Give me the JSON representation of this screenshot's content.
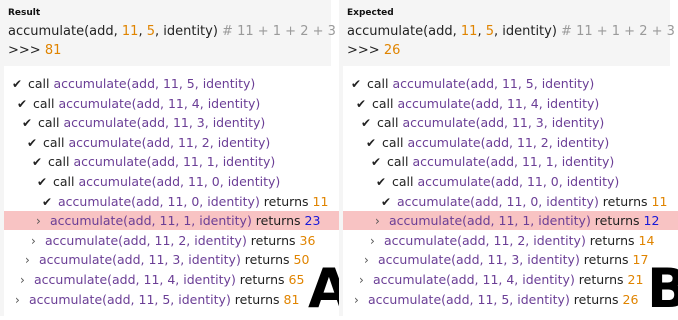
{
  "panels": [
    {
      "title": "Result",
      "expression": "accumulate(add, ",
      "arg1": "11",
      "arg2": "5",
      "expr_tail": ", identity)",
      "comment": " # 11 + 1 + 2 + 3",
      "prompt": ">>> ",
      "prompt_value": "81",
      "calls": [
        "accumulate(add, 11, 5, identity)",
        "accumulate(add, 11, 4, identity)",
        "accumulate(add, 11, 3, identity)",
        "accumulate(add, 11, 2, identity)",
        "accumulate(add, 11, 1, identity)",
        "accumulate(add, 11, 0, identity)"
      ],
      "returns": [
        {
          "call": "accumulate(add, 11, 0, identity)",
          "value": "11",
          "highlight": false
        },
        {
          "call": "accumulate(add, 11, 1, identity)",
          "value": "23",
          "highlight": true
        },
        {
          "call": "accumulate(add, 11, 2, identity)",
          "value": "36",
          "highlight": false
        },
        {
          "call": "accumulate(add, 11, 3, identity)",
          "value": "50",
          "highlight": false
        },
        {
          "call": "accumulate(add, 11, 4, identity)",
          "value": "65",
          "highlight": false
        },
        {
          "call": "accumulate(add, 11, 5, identity)",
          "value": "81",
          "highlight": false
        }
      ],
      "big_label": "A"
    },
    {
      "title": "Expected",
      "expression": "accumulate(add, ",
      "arg1": "11",
      "arg2": "5",
      "expr_tail": ", identity)",
      "comment": " # 11 + 1 + 2 + 3",
      "prompt": ">>> ",
      "prompt_value": "26",
      "calls": [
        "accumulate(add, 11, 5, identity)",
        "accumulate(add, 11, 4, identity)",
        "accumulate(add, 11, 3, identity)",
        "accumulate(add, 11, 2, identity)",
        "accumulate(add, 11, 1, identity)",
        "accumulate(add, 11, 0, identity)"
      ],
      "returns": [
        {
          "call": "accumulate(add, 11, 0, identity)",
          "value": "11",
          "highlight": false
        },
        {
          "call": "accumulate(add, 11, 1, identity)",
          "value": "12",
          "highlight": true
        },
        {
          "call": "accumulate(add, 11, 2, identity)",
          "value": "14",
          "highlight": false
        },
        {
          "call": "accumulate(add, 11, 3, identity)",
          "value": "17",
          "highlight": false
        },
        {
          "call": "accumulate(add, 11, 4, identity)",
          "value": "21",
          "highlight": false
        },
        {
          "call": "accumulate(add, 11, 5, identity)",
          "value": "26",
          "highlight": false
        }
      ],
      "big_label": "B"
    }
  ],
  "words": {
    "call": "call ",
    "returns": " returns "
  },
  "icons": {
    "check": "check-icon",
    "arrow": "chevron-right-icon"
  },
  "colors": {
    "function": "#6b3e96",
    "number": "#e08400",
    "highlight_value": "#1818d8",
    "highlight_row": "#f8c3c3"
  }
}
